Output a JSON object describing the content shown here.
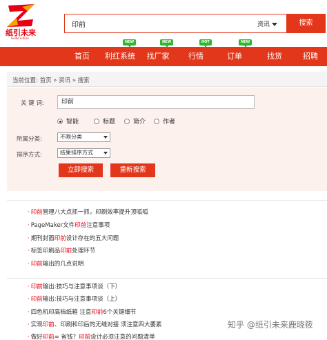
{
  "header": {
    "logo_text": "纸引未来",
    "logo_sub": "Guide Future",
    "search_value": "印前",
    "search_type": "资讯",
    "search_button": "搜索"
  },
  "nav": {
    "items": [
      "首页",
      "利红系统",
      "找厂家",
      "行情",
      "订单",
      "找货",
      "招聘"
    ],
    "badges": [
      "NEW",
      "NEW",
      "HOT",
      "NEW"
    ]
  },
  "breadcrumb": "当前位置: 首页 » 资讯 » 搜索",
  "form": {
    "keyword_label": "关 键 词:",
    "keyword_value": "印前",
    "radios": [
      "智能",
      "标题",
      "简介",
      "作者"
    ],
    "category_label": "所属分类:",
    "category_value": "不限分类",
    "sort_label": "排序方式:",
    "sort_value": "结果排序方式",
    "submit_button": "立即搜索",
    "reset_button": "重新搜索"
  },
  "results": [
    {
      "prefix": "印前",
      "rest": "管理八大点抓一抓，印刷效率提升顶呱呱"
    },
    {
      "pre": "PageMaker文件",
      "hl": "印前",
      "post": "注意事项"
    },
    {
      "pre": "期刊封面",
      "hl": "印前",
      "post": "设计存在的五大问题"
    },
    {
      "pre": "标签印刷品",
      "hl": "印前",
      "post": "处理环节"
    },
    {
      "prefix": "印前",
      "rest": "输出的几点说明"
    },
    {
      "prefix": "印前",
      "rest": "输出:技巧与注意事项谈（下）"
    },
    {
      "prefix": "印前",
      "rest": "输出:技巧与注意事项谈（上）"
    },
    {
      "pre": "四色机印高档纸箱 注意",
      "hl": "印前",
      "post": "6个关键细节"
    },
    {
      "pre": "实现",
      "hl": "印前",
      "post": "、印刷和印后的无缝对接 须注意四大要素"
    },
    {
      "pre": "做好",
      "hl": "印前",
      "post": "= 省钱？",
      "hl2": "印前",
      "post2": "设计必须注意的问题清单"
    }
  ],
  "watermark": "知乎 @纸引未来鹿晓筱",
  "colors": {
    "accent": "#e2371b",
    "badge": "#2eb82e",
    "panel": "#fdf1ee"
  }
}
